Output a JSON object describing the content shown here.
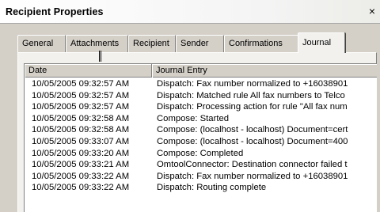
{
  "window": {
    "title": "Recipient Properties",
    "close_symbol": "×"
  },
  "tabs": [
    {
      "label": "General",
      "active": false
    },
    {
      "label": "Attachments",
      "active": false
    },
    {
      "label": "Recipient",
      "active": false
    },
    {
      "label": "Sender",
      "active": false
    },
    {
      "label": "Confirmations",
      "active": false
    },
    {
      "label": "Journal",
      "active": true
    }
  ],
  "journal": {
    "columns": [
      "Date",
      "Journal Entry"
    ],
    "rows": [
      {
        "date": "10/05/2005 09:32:57 AM",
        "entry": "Dispatch: Fax number normalized to +16038901"
      },
      {
        "date": "10/05/2005 09:32:57 AM",
        "entry": "Dispatch: Matched rule All fax numbers to Telco"
      },
      {
        "date": "10/05/2005 09:32:57 AM",
        "entry": "Dispatch: Processing action for rule \"All fax num"
      },
      {
        "date": "10/05/2005 09:32:58 AM",
        "entry": "Compose: Started"
      },
      {
        "date": "10/05/2005 09:32:58 AM",
        "entry": "Compose: (localhost - localhost) Document=cert"
      },
      {
        "date": "10/05/2005 09:33:07 AM",
        "entry": "Compose: (localhost - localhost) Document=400"
      },
      {
        "date": "10/05/2005 09:33:20 AM",
        "entry": "Compose: Completed"
      },
      {
        "date": "10/05/2005 09:33:21 AM",
        "entry": "OmtoolConnector: Destination connector failed t"
      },
      {
        "date": "10/05/2005 09:33:22 AM",
        "entry": "Dispatch: Fax number normalized to +16038901"
      },
      {
        "date": "10/05/2005 09:33:22 AM",
        "entry": "Dispatch: Routing complete"
      }
    ]
  }
}
